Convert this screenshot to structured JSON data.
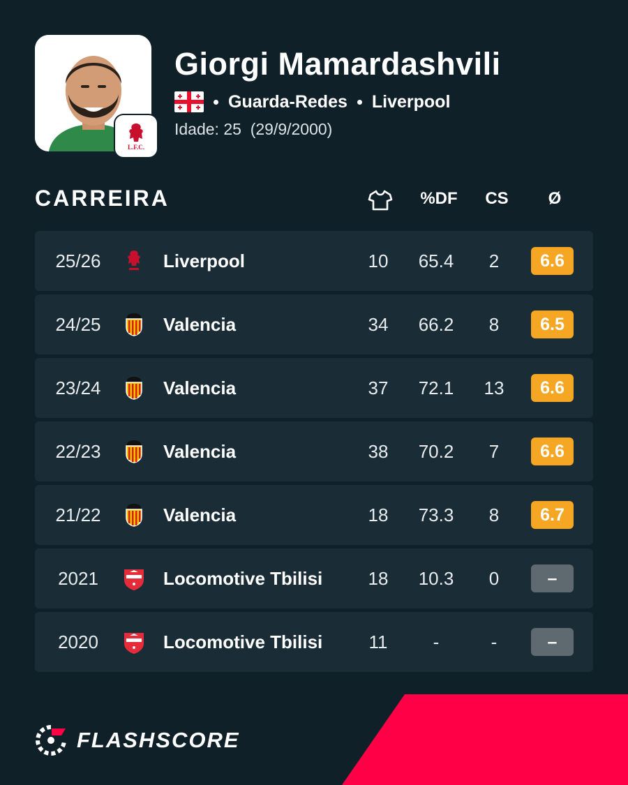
{
  "player": {
    "name": "Giorgi Mamardashvili",
    "position": "Guarda-Redes",
    "club": "Liverpool",
    "age_label": "Idade: 25",
    "birthdate": "(29/9/2000)",
    "flag_icon": "georgia-flag-icon",
    "club_badge_text": "L.F.C."
  },
  "section": {
    "title": "CARREIRA"
  },
  "columns": {
    "appearances_icon": "shirt-icon",
    "pct_df": "%DF",
    "cs": "CS",
    "avg": "Ø"
  },
  "colors": {
    "background": "#0f2029",
    "row_bg": "#1a2d36",
    "rating_orange": "#f5a623",
    "rating_none": "#5f6a70",
    "brand_red": "#ff0046"
  },
  "career": [
    {
      "season": "25/26",
      "team": "Liverpool",
      "crest": "liverpool-crest-icon",
      "apps": "10",
      "pct_df": "65.4",
      "cs": "2",
      "rating": "6.6"
    },
    {
      "season": "24/25",
      "team": "Valencia",
      "crest": "valencia-crest-icon",
      "apps": "34",
      "pct_df": "66.2",
      "cs": "8",
      "rating": "6.5"
    },
    {
      "season": "23/24",
      "team": "Valencia",
      "crest": "valencia-crest-icon",
      "apps": "37",
      "pct_df": "72.1",
      "cs": "13",
      "rating": "6.6"
    },
    {
      "season": "22/23",
      "team": "Valencia",
      "crest": "valencia-crest-icon",
      "apps": "38",
      "pct_df": "70.2",
      "cs": "7",
      "rating": "6.6"
    },
    {
      "season": "21/22",
      "team": "Valencia",
      "crest": "valencia-crest-icon",
      "apps": "18",
      "pct_df": "73.3",
      "cs": "8",
      "rating": "6.7"
    },
    {
      "season": "2021",
      "team": "Locomotive Tbilisi",
      "crest": "locomotive-crest-icon",
      "apps": "18",
      "pct_df": "10.3",
      "cs": "0",
      "rating": "–"
    },
    {
      "season": "2020",
      "team": "Locomotive Tbilisi",
      "crest": "locomotive-crest-icon",
      "apps": "11",
      "pct_df": "-",
      "cs": "-",
      "rating": "–"
    }
  ],
  "brand": {
    "name": "FLASHSCORE",
    "logo_icon": "flashscore-logo-icon"
  }
}
